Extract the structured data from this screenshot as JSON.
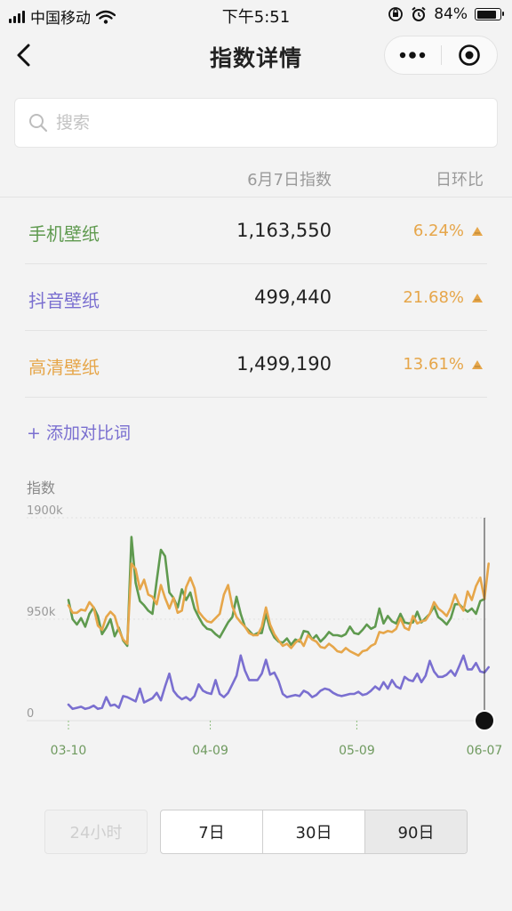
{
  "status_bar": {
    "carrier": "中国移动",
    "time": "下午5:51",
    "battery": "84%",
    "battery_level": 0.84
  },
  "nav": {
    "title": "指数详情",
    "back_icon": "chevron-left-icon",
    "more_icon": "more-dots-icon",
    "close_icon": "target-icon"
  },
  "search": {
    "placeholder": "搜索",
    "value": ""
  },
  "table": {
    "header_index": "6月7日指数",
    "header_ratio": "日环比",
    "rows": [
      {
        "keyword": "手机壁纸",
        "index": "1,163,550",
        "ratio": "6.24%",
        "color": "#5f9a4f"
      },
      {
        "keyword": "抖音壁纸",
        "index": "499,440",
        "ratio": "21.68%",
        "color": "#7a6fd0"
      },
      {
        "keyword": "高清壁纸",
        "index": "1,499,190",
        "ratio": "13.61%",
        "color": "#e6a64a"
      }
    ],
    "ratio_color": "#e6a64a"
  },
  "add_compare": "+ 添加对比词",
  "chart_data": {
    "type": "line",
    "ylabel": "指数",
    "y_ticks": [
      "1900k",
      "950k",
      "0"
    ],
    "x_ticks": [
      "03-10",
      "04-09",
      "05-09",
      "06-07"
    ],
    "ylim": [
      0,
      1900000
    ],
    "grid": true,
    "series": [
      {
        "name": "手机壁纸",
        "color": "#5f9a4f",
        "values": [
          1130000,
          950000,
          900000,
          960000,
          880000,
          1000000,
          1060000,
          980000,
          810000,
          870000,
          950000,
          790000,
          870000,
          750000,
          700000,
          1720000,
          1290000,
          1120000,
          1080000,
          1030000,
          1000000,
          1310000,
          1600000,
          1540000,
          1200000,
          1150000,
          1060000,
          1230000,
          1130000,
          1200000,
          1050000,
          970000,
          900000,
          860000,
          850000,
          810000,
          780000,
          850000,
          920000,
          970000,
          1160000,
          1000000,
          880000,
          840000,
          800000,
          820000,
          820000,
          1000000,
          860000,
          780000,
          740000,
          730000,
          770000,
          710000,
          760000,
          740000,
          840000,
          830000,
          760000,
          800000,
          740000,
          780000,
          830000,
          800000,
          800000,
          790000,
          810000,
          880000,
          820000,
          810000,
          850000,
          900000,
          860000,
          880000,
          1050000,
          910000,
          980000,
          930000,
          910000,
          1000000,
          920000,
          910000,
          920000,
          1020000,
          920000,
          960000,
          1000000,
          1070000,
          970000,
          940000,
          900000,
          960000,
          1090000,
          1090000,
          1050000,
          1020000,
          1050000,
          1000000,
          1120000,
          1140000
        ]
      },
      {
        "name": "抖音壁纸",
        "color": "#7a6fd0",
        "values": [
          150000,
          110000,
          120000,
          130000,
          110000,
          120000,
          140000,
          110000,
          120000,
          220000,
          140000,
          150000,
          120000,
          230000,
          220000,
          200000,
          180000,
          300000,
          170000,
          190000,
          210000,
          260000,
          190000,
          320000,
          440000,
          280000,
          230000,
          200000,
          220000,
          190000,
          230000,
          340000,
          280000,
          260000,
          250000,
          380000,
          250000,
          220000,
          260000,
          340000,
          420000,
          610000,
          470000,
          380000,
          380000,
          380000,
          440000,
          570000,
          430000,
          450000,
          370000,
          250000,
          220000,
          230000,
          240000,
          230000,
          280000,
          260000,
          220000,
          240000,
          280000,
          300000,
          290000,
          260000,
          240000,
          230000,
          240000,
          250000,
          250000,
          270000,
          240000,
          250000,
          280000,
          320000,
          290000,
          360000,
          300000,
          380000,
          320000,
          300000,
          410000,
          380000,
          370000,
          440000,
          360000,
          420000,
          560000,
          460000,
          410000,
          410000,
          430000,
          470000,
          420000,
          510000,
          610000,
          480000,
          480000,
          540000,
          460000,
          450000,
          500000
        ]
      },
      {
        "name": "高清壁纸",
        "color": "#e6a64a",
        "values": [
          1080000,
          1010000,
          1010000,
          1040000,
          1030000,
          1110000,
          1060000,
          890000,
          850000,
          970000,
          1020000,
          980000,
          850000,
          760000,
          720000,
          1470000,
          1420000,
          1230000,
          1320000,
          1180000,
          1160000,
          1090000,
          1270000,
          1150000,
          1050000,
          1150000,
          1010000,
          1030000,
          1250000,
          1340000,
          1240000,
          1020000,
          970000,
          930000,
          920000,
          960000,
          1000000,
          1180000,
          1270000,
          1070000,
          970000,
          920000,
          880000,
          820000,
          800000,
          800000,
          880000,
          1060000,
          900000,
          810000,
          750000,
          700000,
          720000,
          680000,
          730000,
          760000,
          700000,
          800000,
          760000,
          740000,
          690000,
          680000,
          720000,
          690000,
          650000,
          640000,
          680000,
          650000,
          630000,
          610000,
          650000,
          660000,
          700000,
          720000,
          830000,
          820000,
          840000,
          830000,
          860000,
          960000,
          870000,
          850000,
          980000,
          910000,
          930000,
          940000,
          1000000,
          1110000,
          1050000,
          1020000,
          980000,
          1060000,
          1180000,
          1090000,
          1030000,
          1210000,
          1130000,
          1260000,
          1340000,
          1140000,
          1470000
        ]
      }
    ]
  },
  "range": {
    "h24": "24小时",
    "d7": "7日",
    "d30": "30日",
    "d90": "90日"
  }
}
